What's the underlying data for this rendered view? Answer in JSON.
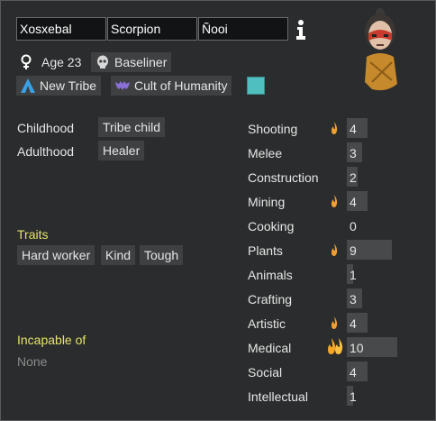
{
  "name_fields": {
    "first": "Xosxebal",
    "nick": "Scorpion",
    "last": "Ñooi"
  },
  "bio": {
    "age_label": "Age 23",
    "xenotype": "Baseliner"
  },
  "factions": {
    "faction": "New Tribe",
    "ideology": "Cult of Humanity",
    "ideology_color": "#4fbfbf"
  },
  "backstory": {
    "childhood_label": "Childhood",
    "childhood_value": "Tribe child",
    "adulthood_label": "Adulthood",
    "adulthood_value": "Healer"
  },
  "traits": {
    "label": "Traits",
    "items": [
      "Hard worker",
      "Kind",
      "Tough"
    ]
  },
  "incapable": {
    "label": "Incapable of",
    "value": "None"
  },
  "skills": [
    {
      "name": "Shooting",
      "level": "4",
      "passion": "minor"
    },
    {
      "name": "Melee",
      "level": "3",
      "passion": "none"
    },
    {
      "name": "Construction",
      "level": "2",
      "passion": "none"
    },
    {
      "name": "Mining",
      "level": "4",
      "passion": "minor"
    },
    {
      "name": "Cooking",
      "level": "0",
      "passion": "none"
    },
    {
      "name": "Plants",
      "level": "9",
      "passion": "minor"
    },
    {
      "name": "Animals",
      "level": "1",
      "passion": "none"
    },
    {
      "name": "Crafting",
      "level": "3",
      "passion": "none"
    },
    {
      "name": "Artistic",
      "level": "4",
      "passion": "minor"
    },
    {
      "name": "Medical",
      "level": "10",
      "passion": "major"
    },
    {
      "name": "Social",
      "level": "4",
      "passion": "none"
    },
    {
      "name": "Intellectual",
      "level": "1",
      "passion": "none"
    }
  ],
  "icons": {
    "info": "info-icon",
    "gender": "female-gender-icon",
    "xenotype": "skull-icon",
    "faction": "tribe-tent-icon",
    "ideology": "bat-wings-icon",
    "passion": "flame-icon"
  }
}
